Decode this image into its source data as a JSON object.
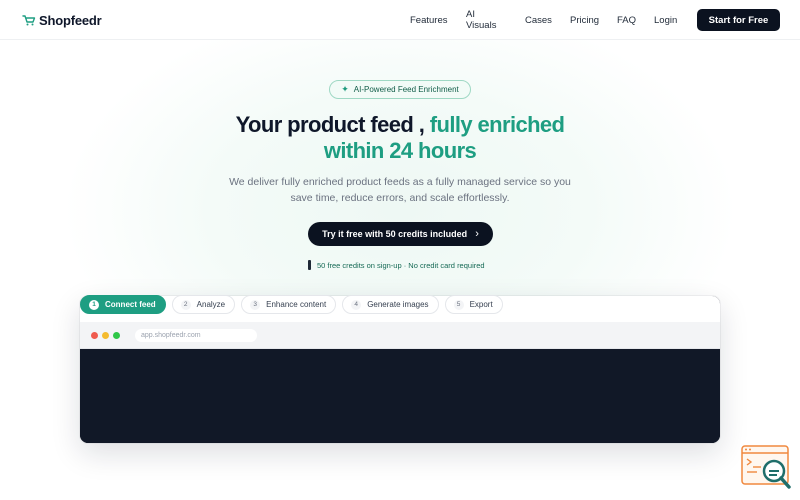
{
  "header": {
    "logo_text": "Shopfeedr",
    "logo_icon": "shopfeedr-logo-icon",
    "nav": [
      "Features",
      "AI Visuals",
      "Cases",
      "Pricing",
      "FAQ",
      "Login"
    ],
    "cta_label": "Start for Free"
  },
  "hero": {
    "badge_icon": "sparkle-icon",
    "badge_text": "AI-Powered Feed Enrichment",
    "title_dark": "Your product feed ,",
    "title_accent_1": "fully enriched",
    "title_accent_2": "within 24 hours",
    "subtitle": "We deliver fully enriched product feeds as a fully managed service so you save time, reduce errors, and scale effortlessly.",
    "cta_label": "Try it free with 50 credits included",
    "cta_icon": "chevron-right-icon",
    "note": "50 free credits on sign-up · No credit card required"
  },
  "steps": [
    {
      "num": "1",
      "label": "Connect feed",
      "active": true
    },
    {
      "num": "2",
      "label": "Analyze",
      "active": false
    },
    {
      "num": "3",
      "label": "Enhance content",
      "active": false
    },
    {
      "num": "4",
      "label": "Generate images",
      "active": false
    },
    {
      "num": "5",
      "label": "Export",
      "active": false
    }
  ],
  "browser": {
    "url": "app.shopfeedr.com"
  },
  "colors": {
    "accent": "#1e9e82",
    "dark": "#0b1220",
    "badge_border": "#9fd8c4",
    "widget_orange": "#f0883e",
    "widget_teal": "#1f6e6a"
  },
  "corner_widget": {
    "icon": "search-help-widget-icon"
  }
}
